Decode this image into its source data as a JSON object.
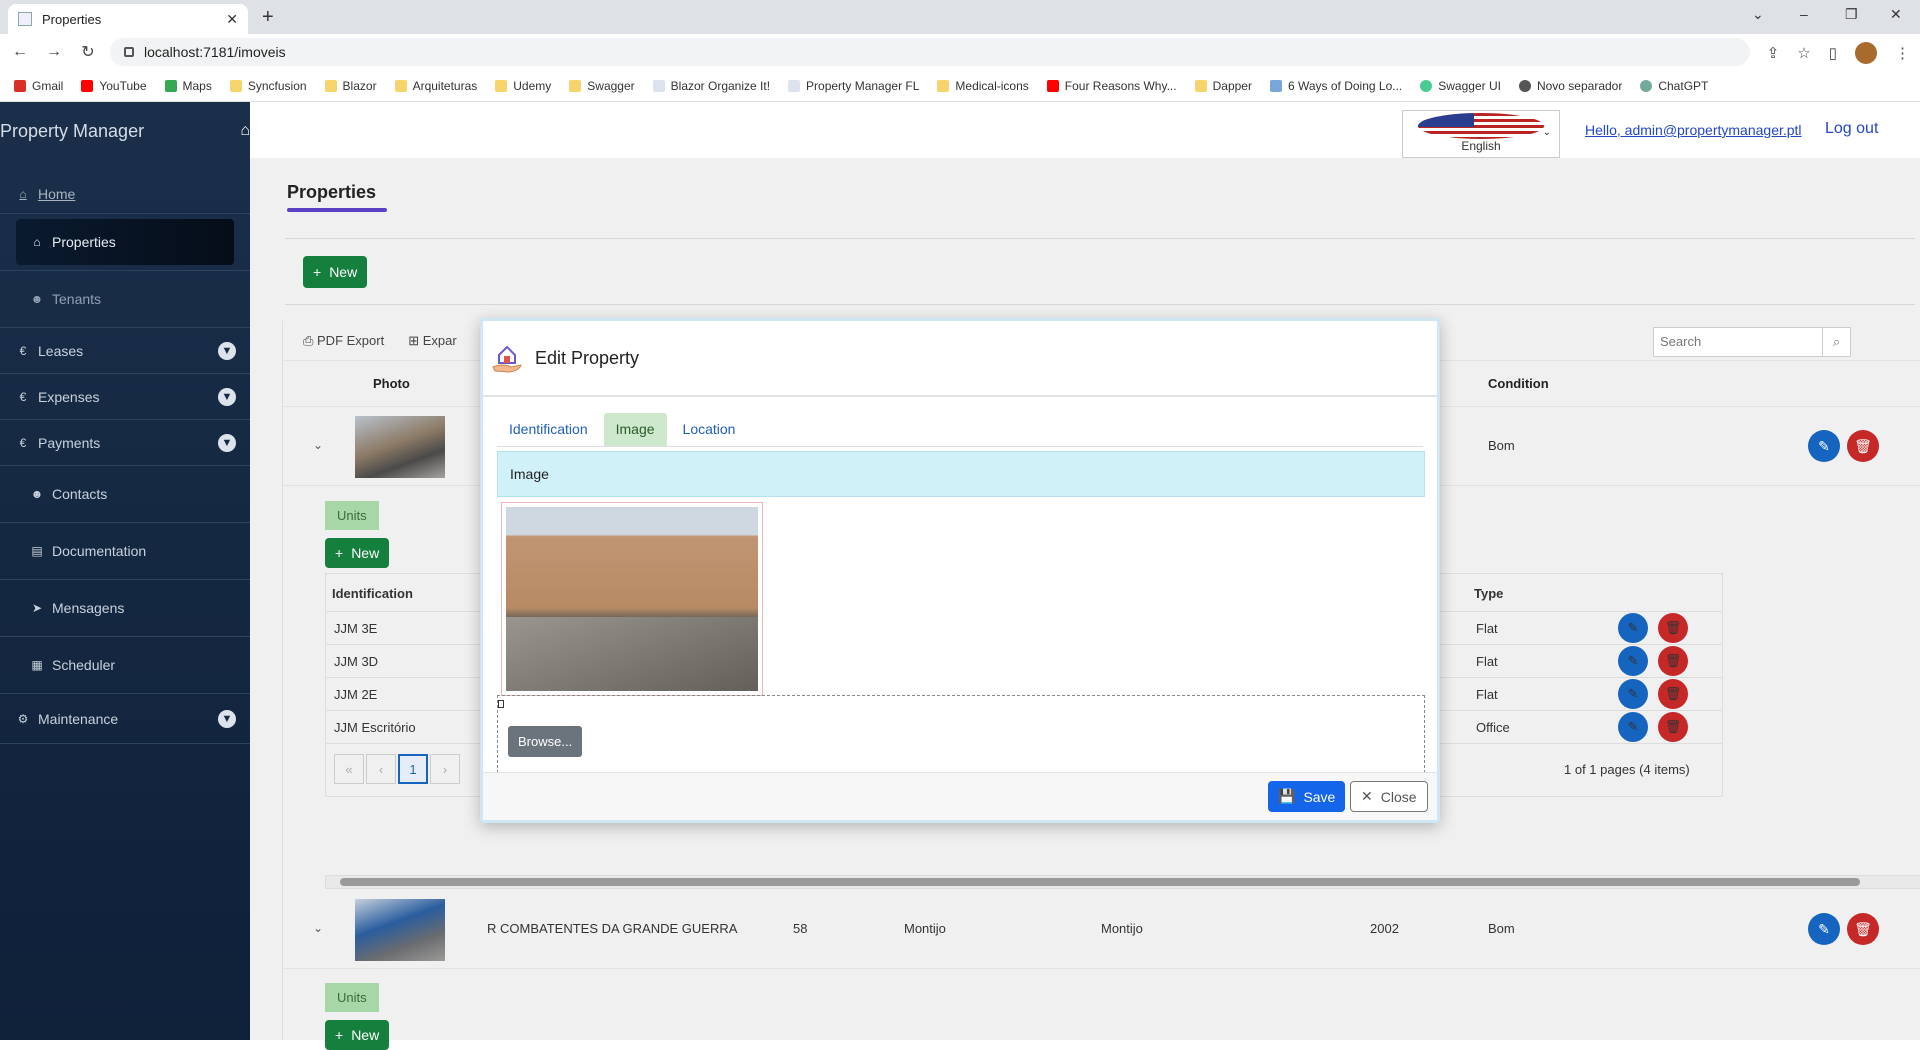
{
  "browser": {
    "tab_title": "Properties",
    "url": "localhost:7181/imoveis",
    "bookmarks": [
      "Gmail",
      "YouTube",
      "Maps",
      "Syncfusion",
      "Blazor",
      "Arquiteturas",
      "Udemy",
      "Swagger",
      "Blazor Organize It!",
      "Property Manager FL",
      "Medical-icons",
      "Four Reasons Why...",
      "Dapper",
      "6 Ways of Doing Lo...",
      "Swagger UI",
      "Novo separador",
      "ChatGPT"
    ]
  },
  "sidebar": {
    "brand": "Property Manager",
    "home": "Home",
    "items": {
      "properties": "Properties",
      "tenants": "Tenants",
      "leases": "Leases",
      "expenses": "Expenses",
      "payments": "Payments",
      "contacts": "Contacts",
      "documentation": "Documentation",
      "mensagens": "Mensagens",
      "scheduler": "Scheduler",
      "maintenance": "Maintenance"
    }
  },
  "topbar": {
    "language": "English",
    "hello": "Hello, admin@propertymanager.ptl",
    "logout": "Log out"
  },
  "page": {
    "title": "Properties",
    "new_label": "New",
    "toolbar": {
      "pdf_export": "PDF Export",
      "expand": "Expar"
    },
    "search_placeholder": "Search",
    "columns": {
      "photo": "Photo",
      "condition": "Condition"
    },
    "rows": [
      {
        "condition": "Bom"
      },
      {
        "address": "R COMBATENTES DA GRANDE GUERRA",
        "number": "58",
        "city": "Montijo",
        "parish": "Montijo",
        "year": "2002",
        "condition": "Bom"
      }
    ],
    "units_tab": "Units",
    "units_new": "New",
    "units_columns": {
      "identification": "Identification",
      "type": "Type"
    },
    "units": [
      {
        "identification": "JJM 3E",
        "type": "Flat"
      },
      {
        "identification": "JJM 3D",
        "type": "Flat"
      },
      {
        "identification": "JJM 2E",
        "type": "Flat"
      },
      {
        "identification": "JJM Escritório",
        "type": "Office"
      }
    ],
    "pager_current": "1",
    "pager_info": "1 of 1 pages (4 items)"
  },
  "modal": {
    "title": "Edit Property",
    "tabs": {
      "identification": "Identification",
      "image": "Image",
      "location": "Location"
    },
    "section_label": "Image",
    "browse_label": "Browse...",
    "save_label": "Save",
    "close_label": "Close"
  }
}
